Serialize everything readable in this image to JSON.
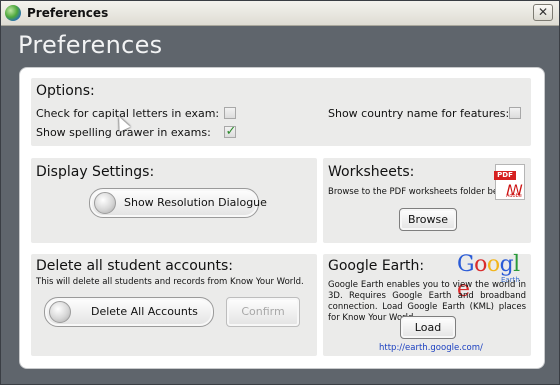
{
  "window": {
    "title": "Preferences",
    "close_glyph": "✕"
  },
  "heading": "Preferences",
  "options": {
    "title": "Options:",
    "check_capitals_label": "Check for capital letters in exam:",
    "check_capitals_checked": false,
    "show_spelling_label": "Show spelling drawer in exams:",
    "show_spelling_checked": true,
    "show_country_label": "Show country name for features:",
    "show_country_checked": false,
    "check_glyph": "✓"
  },
  "display": {
    "title": "Display Settings:",
    "resolution_button": "Show Resolution Dialogue"
  },
  "worksheets": {
    "title": "Worksheets:",
    "description": "Browse to the PDF worksheets folder below.",
    "browse_button": "Browse",
    "pdf_badge": "PDF",
    "pdf_caption": "Adobe"
  },
  "delete": {
    "title": "Delete all student accounts:",
    "description": "This will delete all students and records from Know Your World.",
    "delete_button": "Delete All Accounts",
    "confirm_button": "Confirm"
  },
  "google_earth": {
    "title": "Google Earth:",
    "logo": [
      "G",
      "o",
      "o",
      "g",
      "l",
      "e"
    ],
    "logo_colors": [
      "#2a5bd7",
      "#d92b2b",
      "#f2b51c",
      "#2a5bd7",
      "#2a9a3b",
      "#d92b2b"
    ],
    "logo_sub": "Earth",
    "description": "Google Earth enables you to view the world in 3D. Requires Google Earth and broadband connection. Load Google Earth (KML) places for Know Your World.",
    "load_button": "Load",
    "link": "http://earth.google.com/"
  },
  "colors": {
    "panel": "#ebebea",
    "link": "#1a3fc0",
    "check": "#2c8a2c"
  }
}
